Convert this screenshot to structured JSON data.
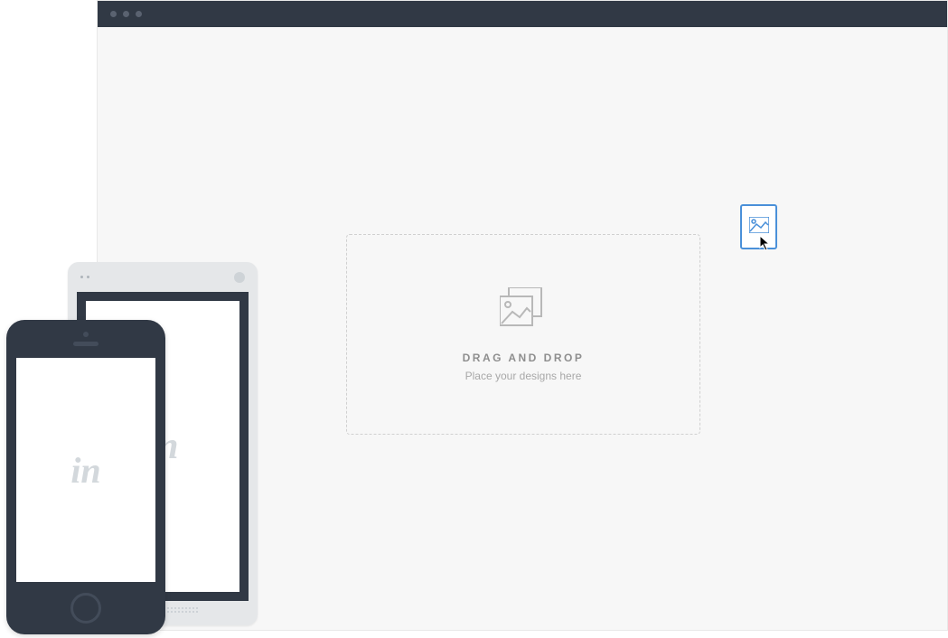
{
  "dropzone": {
    "title": "DRAG AND DROP",
    "subtitle": "Place your designs here"
  },
  "logos": {
    "back": "in",
    "front": "in"
  }
}
